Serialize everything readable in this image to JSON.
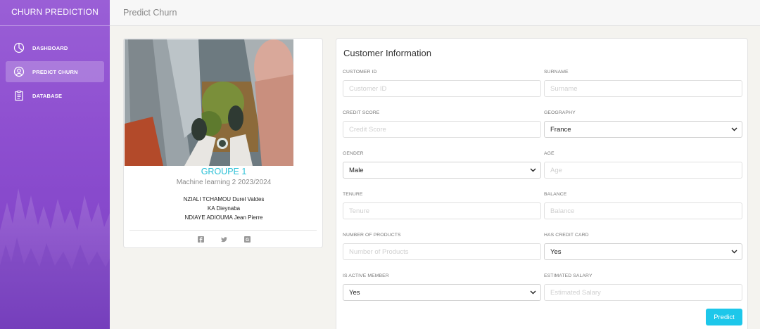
{
  "app": {
    "title": "CHURN PREDICTION"
  },
  "sidebar": {
    "items": [
      {
        "label": "DASHBOARD",
        "icon": "pie-chart-icon"
      },
      {
        "label": "PREDICT CHURN",
        "icon": "user-circle-icon",
        "active": true
      },
      {
        "label": "DATABASE",
        "icon": "clipboard-icon"
      }
    ]
  },
  "topbar": {
    "title": "Predict Churn"
  },
  "profile": {
    "group": "GROUPE 1",
    "subtitle": "Machine learning 2 2023/2024",
    "members": [
      "NZIALI TCHAMOU Durel Valdes",
      "KA Dieynaba",
      "NDIAYE ADIOUMA Jean Pierre"
    ],
    "socials": [
      "facebook-icon",
      "twitter-icon",
      "google-plus-icon"
    ]
  },
  "form": {
    "title": "Customer Information",
    "fields": {
      "customer_id": {
        "label": "CUSTOMER ID",
        "placeholder": "Customer ID"
      },
      "surname": {
        "label": "SURNAME",
        "placeholder": "Surname"
      },
      "credit_score": {
        "label": "CREDIT SCORE",
        "placeholder": "Credit Score"
      },
      "geography": {
        "label": "GEOGRAPHY",
        "value": "France"
      },
      "gender": {
        "label": "GENDER",
        "value": "Male"
      },
      "age": {
        "label": "AGE",
        "placeholder": "Age"
      },
      "tenure": {
        "label": "TENURE",
        "placeholder": "Tenure"
      },
      "balance": {
        "label": "BALANCE",
        "placeholder": "Balance"
      },
      "num_products": {
        "label": "NUMBER OF PRODUCTS",
        "placeholder": "Number of Products"
      },
      "has_credit_card": {
        "label": "HAS CREDIT CARD",
        "value": "Yes"
      },
      "is_active_member": {
        "label": "IS ACTIVE MEMBER",
        "value": "Yes"
      },
      "estimated_salary": {
        "label": "ESTIMATED SALARY",
        "placeholder": "Estimated Salary"
      }
    },
    "submit_label": "Predict"
  },
  "colors": {
    "accent": "#1dc7ea",
    "sidebar": "#8e4fd0",
    "group_title": "#27bfd6"
  }
}
